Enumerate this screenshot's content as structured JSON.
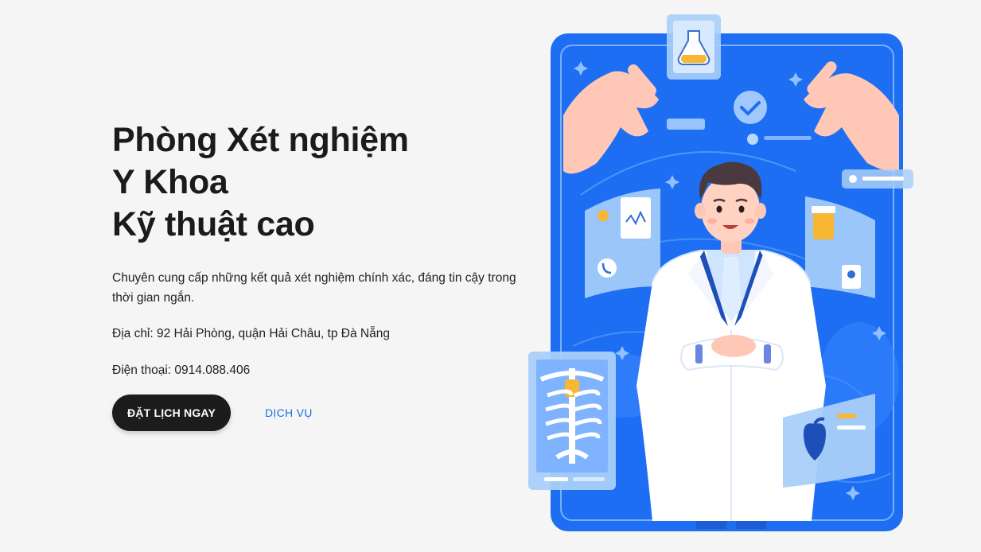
{
  "hero": {
    "title_lines": [
      "Phòng Xét nghiệm",
      "Y Khoa",
      "Kỹ thuật cao"
    ],
    "description": "Chuyên cung cấp những kết quả xét nghiệm chính xác, đáng tin cậy trong thời gian ngắn.",
    "address": "Địa chỉ: 92 Hải Phòng, quận Hải Châu, tp Đà Nẵng",
    "phone": "Điện thoại: 0914.088.406"
  },
  "actions": {
    "primary_label": "ĐẶT LỊCH NGAY",
    "secondary_label": "DỊCH VỤ"
  },
  "illustration": {
    "subject": "doctor-in-lab-coat",
    "colors": {
      "panel": "#1d6ef2",
      "accent": "#1a6fe0",
      "coat": "#ffffff",
      "skin": "#ffd2c2"
    }
  }
}
